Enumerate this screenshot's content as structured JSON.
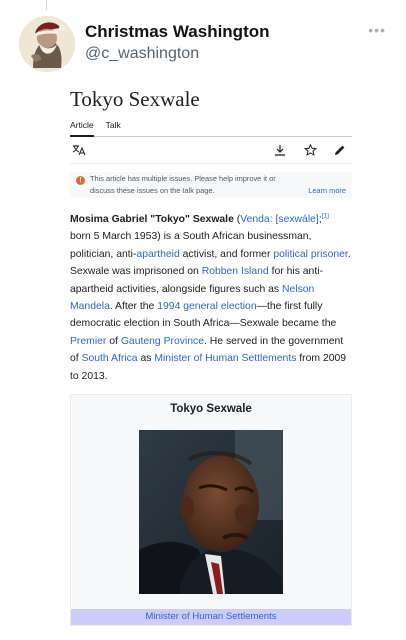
{
  "tweet": {
    "display_name": "Christmas Washington",
    "handle": "@c_washington",
    "more_icon": "more-horizontal-icon"
  },
  "article": {
    "title": "Tokyo Sexwale",
    "tabs": [
      {
        "label": "Article",
        "active": true
      },
      {
        "label": "Talk",
        "active": false
      }
    ],
    "tools": [
      "translate-icon",
      "download-icon",
      "star-icon",
      "edit-icon"
    ],
    "notice": {
      "text_line1": "This article has multiple issues. Please help improve it or",
      "text_line2": "discuss these issues on the talk page.",
      "link": "Learn more"
    },
    "paragraph": [
      {
        "text": "Mosima Gabriel \"Tokyo\" Sexwale",
        "style": "bold"
      },
      {
        "text": " (",
        "style": "plain"
      },
      {
        "text": "Venda",
        "style": "link"
      },
      {
        "text": ": ",
        "style": "link"
      },
      {
        "text": "[sexwále]",
        "style": "link"
      },
      {
        "text": ";",
        "style": "plain"
      },
      {
        "text": "[1]",
        "style": "sup"
      },
      {
        "text": " born 5 March 1953) is a South African businessman, politician, anti-",
        "style": "plain"
      },
      {
        "text": "apartheid",
        "style": "link"
      },
      {
        "text": " activist, and former ",
        "style": "plain"
      },
      {
        "text": "political prisoner",
        "style": "link"
      },
      {
        "text": ". Sexwale was imprisoned on ",
        "style": "plain"
      },
      {
        "text": "Robben Island",
        "style": "link"
      },
      {
        "text": " for his anti-apartheid activities, alongside figures such as ",
        "style": "plain"
      },
      {
        "text": "Nelson Mandela",
        "style": "link"
      },
      {
        "text": ". After the ",
        "style": "plain"
      },
      {
        "text": "1994 general election",
        "style": "link"
      },
      {
        "text": "—the first fully democratic election in South Africa—Sexwale became the ",
        "style": "plain"
      },
      {
        "text": "Premier",
        "style": "link"
      },
      {
        "text": " of ",
        "style": "plain"
      },
      {
        "text": "Gauteng Province",
        "style": "link"
      },
      {
        "text": ". He served in the government of ",
        "style": "plain"
      },
      {
        "text": "South Africa",
        "style": "link"
      },
      {
        "text": " as ",
        "style": "plain"
      },
      {
        "text": "Minister of Human Settlements",
        "style": "link"
      },
      {
        "text": " from 2009 to 2013.",
        "style": "plain"
      }
    ],
    "infobox": {
      "name": "Tokyo Sexwale",
      "office": "Minister of Human Settlements"
    }
  },
  "colors": {
    "link": "#3366cc",
    "office_bar": "#ccccff",
    "notice_icon": "#e06c33"
  }
}
